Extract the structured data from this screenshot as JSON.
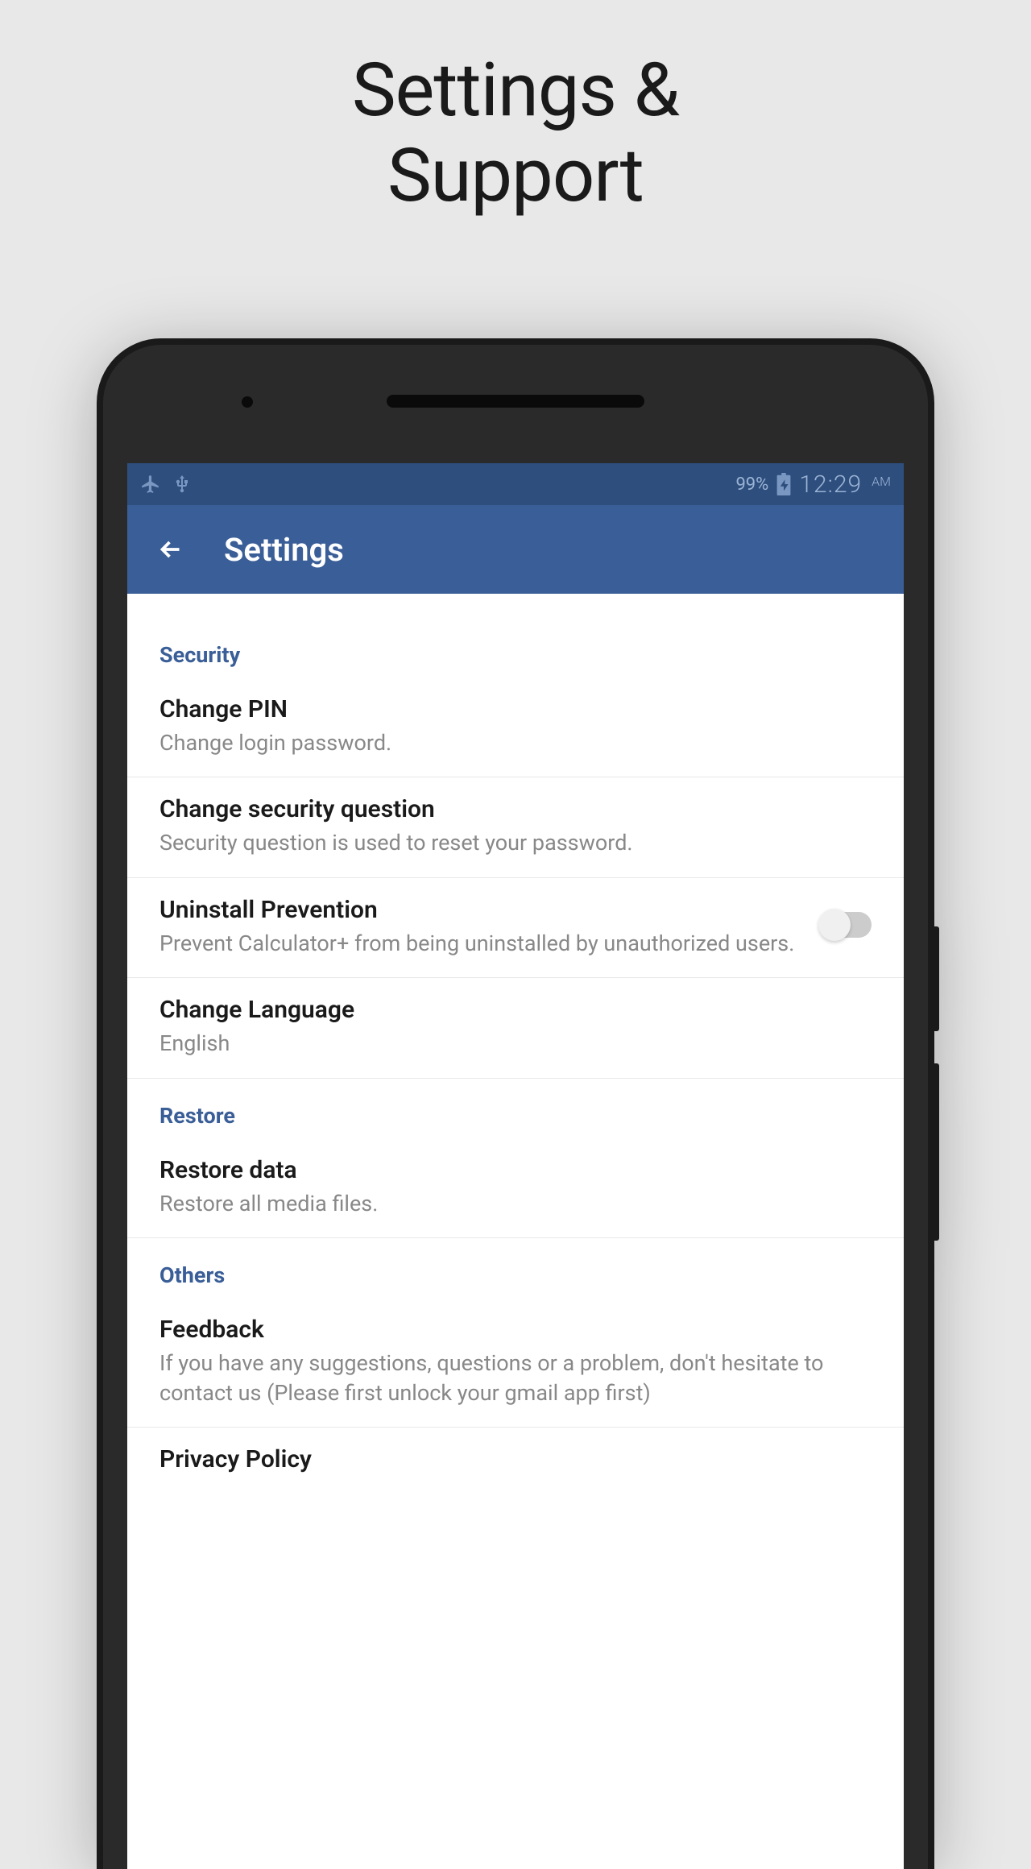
{
  "page_heading_line1": "Settings &",
  "page_heading_line2": "Support",
  "status_bar": {
    "battery": "99%",
    "time": "12:29",
    "ampm": "AM"
  },
  "app_bar": {
    "title": "Settings"
  },
  "sections": {
    "security": {
      "header": "Security",
      "items": {
        "change_pin": {
          "title": "Change PIN",
          "subtitle": "Change login password."
        },
        "change_security_question": {
          "title": "Change security question",
          "subtitle": "Security question is used to reset your password."
        },
        "uninstall_prevention": {
          "title": "Uninstall Prevention",
          "subtitle": "Prevent Calculator+ from being uninstalled by unauthorized users."
        },
        "change_language": {
          "title": "Change Language",
          "subtitle": "English"
        }
      }
    },
    "restore": {
      "header": "Restore",
      "items": {
        "restore_data": {
          "title": "Restore data",
          "subtitle": "Restore all media files."
        }
      }
    },
    "others": {
      "header": "Others",
      "items": {
        "feedback": {
          "title": "Feedback",
          "subtitle": "If you have any suggestions, questions or a problem, don't hesitate to contact us (Please first unlock your gmail app first)"
        },
        "privacy_policy": {
          "title": "Privacy Policy"
        }
      }
    }
  }
}
